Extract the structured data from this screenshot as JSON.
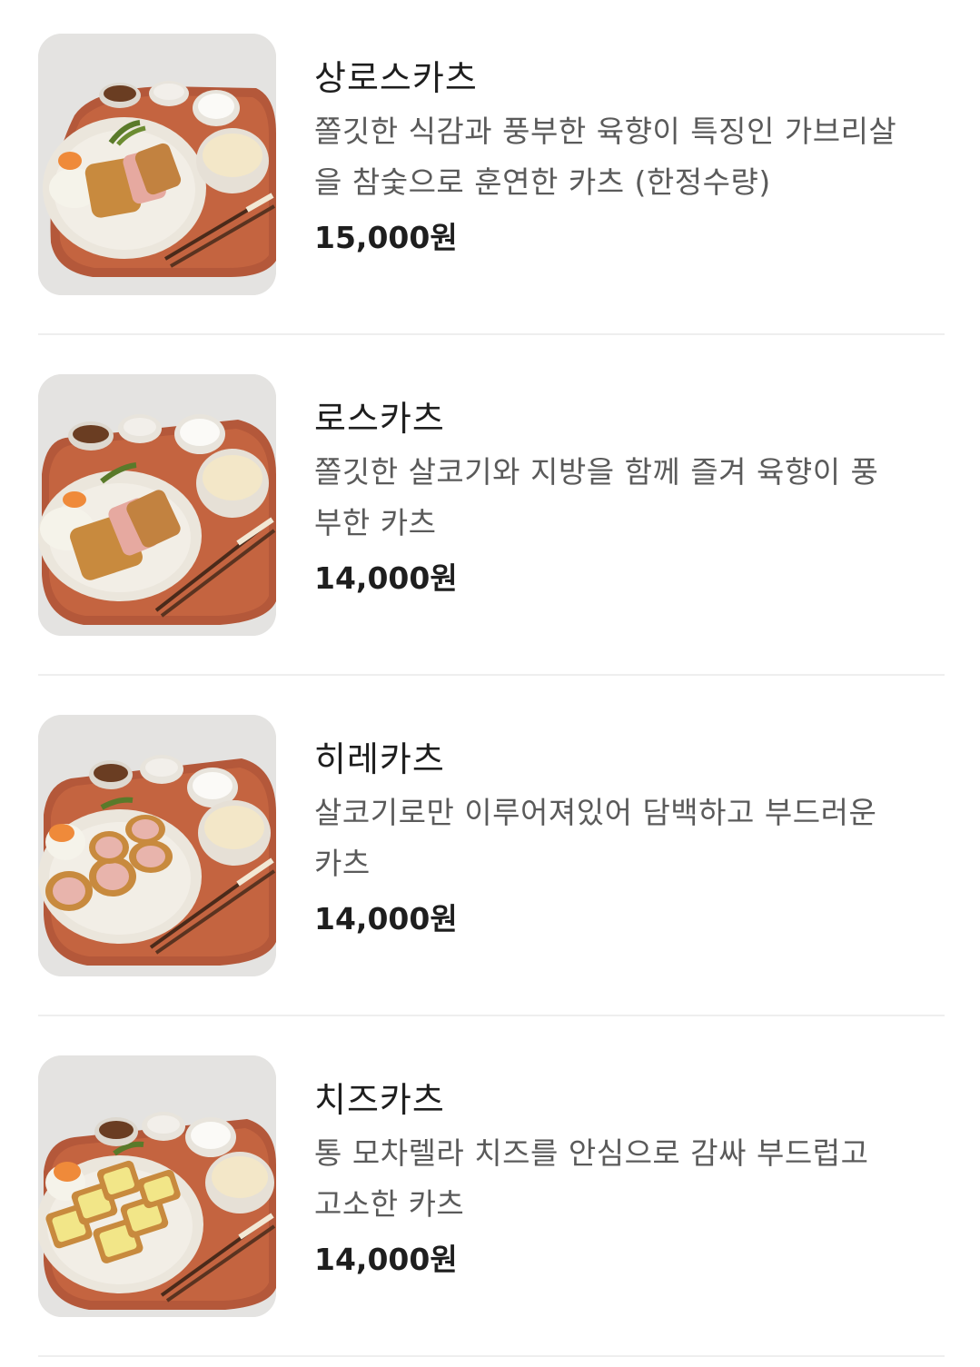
{
  "menu": {
    "items": [
      {
        "name": "상로스카츠",
        "description": "쫄깃한 식감과 풍부한 육향이 특징인 가브리살을 참숯으로 훈연한 카츠 (한정수량)",
        "desc_line1": "쫄깃한 식감과 풍부한 육향이 특징인 가브리살",
        "desc_line2": "을 참숯으로 훈연한 카츠 (한정수량)",
        "price": "15,000원",
        "photo_icon": "katsu-plate-photo"
      },
      {
        "name": "로스카츠",
        "description": "쫄깃한 살코기와 지방을 함께 즐겨 육향이 풍부한 카츠",
        "desc_line1": "쫄깃한 살코기와 지방을 함께 즐겨 육향이 풍",
        "desc_line2": "부한 카츠",
        "price": "14,000원",
        "photo_icon": "katsu-plate-photo"
      },
      {
        "name": "히레카츠",
        "description": "살코기로만 이루어져있어 담백하고 부드러운 카츠",
        "desc_line1": "살코기로만 이루어져있어 담백하고 부드러운",
        "desc_line2": "카츠",
        "price": "14,000원",
        "photo_icon": "katsu-plate-photo"
      },
      {
        "name": "치즈카츠",
        "description": "통 모차렐라 치즈를 안심으로 감싸 부드럽고 고소한 카츠",
        "desc_line1": "통 모차렐라 치즈를 안심으로 감싸 부드럽고",
        "desc_line2": "고소한 카츠",
        "price": "14,000원",
        "photo_icon": "cheese-katsu-plate-photo"
      }
    ]
  },
  "colors": {
    "text_primary": "#1e1e1e",
    "text_secondary": "#5a5a5a",
    "divider": "#eeeeee",
    "tray": "#b4583a",
    "plate": "#ebe6dc",
    "cutlet": "#c88a3e"
  }
}
